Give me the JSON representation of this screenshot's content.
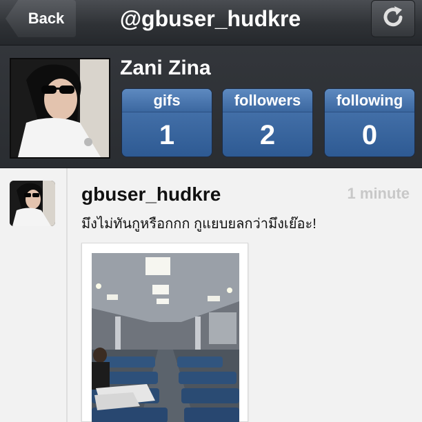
{
  "navbar": {
    "back_label": "Back",
    "title": "@gbuser_hudkre",
    "refresh_icon": "refresh-icon"
  },
  "profile": {
    "name": "Zani Zina",
    "stats": [
      {
        "label": "gifs",
        "value": "1"
      },
      {
        "label": "followers",
        "value": "2"
      },
      {
        "label": "following",
        "value": "0"
      }
    ]
  },
  "post": {
    "username": "gbuser_hudkre",
    "time": "1 minute",
    "text": "มึงไม่ทันกูหรือกกก กูแยบยลกว่ามึงเย๊อะ!"
  },
  "colors": {
    "navbar": "#2f3236",
    "stat_blue": "#3b67a0",
    "feed_bg": "#f2f2f2"
  }
}
